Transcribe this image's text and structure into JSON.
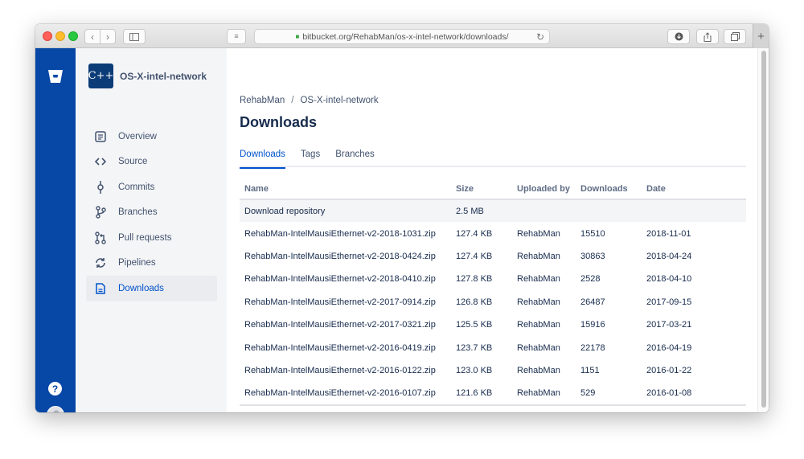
{
  "browser": {
    "url": "bitbucket.org/RehabMan/os-x-intel-network/downloads/",
    "back_icon": "chevron-left",
    "forward_icon": "chevron-right",
    "sidebar_toggle_icon": "sidebar",
    "reader_icon": "reader",
    "download_icon": "download",
    "share_icon": "share",
    "tabs_icon": "tab-overview",
    "new_tab_icon": "plus",
    "traffic_lights": {
      "close": "#fe5f57",
      "minimize": "#febc2e",
      "zoom": "#28c840"
    }
  },
  "rail": {
    "logo_icon": "bitbucket-logo",
    "help_label": "?",
    "user_icon": "user-avatar",
    "color": "#0747a6"
  },
  "repo": {
    "avatar_text": "C++",
    "name": "OS-X-intel-network"
  },
  "sidebar": {
    "items": [
      {
        "label": "Overview",
        "icon": "overview-icon"
      },
      {
        "label": "Source",
        "icon": "source-icon"
      },
      {
        "label": "Commits",
        "icon": "commits-icon"
      },
      {
        "label": "Branches",
        "icon": "branches-icon"
      },
      {
        "label": "Pull requests",
        "icon": "pull-requests-icon"
      },
      {
        "label": "Pipelines",
        "icon": "pipelines-icon"
      },
      {
        "label": "Downloads",
        "icon": "downloads-icon",
        "active": true
      }
    ]
  },
  "breadcrumb": {
    "owner": "RehabMan",
    "separator": "/",
    "repo": "OS-X-intel-network"
  },
  "page_title": "Downloads",
  "tabs": [
    {
      "label": "Downloads",
      "active": true
    },
    {
      "label": "Tags"
    },
    {
      "label": "Branches"
    }
  ],
  "table": {
    "headers": [
      "Name",
      "Size",
      "Uploaded by",
      "Downloads",
      "Date"
    ],
    "repo_row": {
      "name": "Download repository",
      "size": "2.5 MB"
    },
    "rows": [
      {
        "name": "RehabMan-IntelMausiEthernet-v2-2018-1031.zip",
        "size": "127.4 KB",
        "uploader": "RehabMan",
        "downloads": "15510",
        "date": "2018-11-01"
      },
      {
        "name": "RehabMan-IntelMausiEthernet-v2-2018-0424.zip",
        "size": "127.4 KB",
        "uploader": "RehabMan",
        "downloads": "30863",
        "date": "2018-04-24"
      },
      {
        "name": "RehabMan-IntelMausiEthernet-v2-2018-0410.zip",
        "size": "127.8 KB",
        "uploader": "RehabMan",
        "downloads": "2528",
        "date": "2018-04-10"
      },
      {
        "name": "RehabMan-IntelMausiEthernet-v2-2017-0914.zip",
        "size": "126.8 KB",
        "uploader": "RehabMan",
        "downloads": "26487",
        "date": "2017-09-15"
      },
      {
        "name": "RehabMan-IntelMausiEthernet-v2-2017-0321.zip",
        "size": "125.5 KB",
        "uploader": "RehabMan",
        "downloads": "15916",
        "date": "2017-03-21"
      },
      {
        "name": "RehabMan-IntelMausiEthernet-v2-2016-0419.zip",
        "size": "123.7 KB",
        "uploader": "RehabMan",
        "downloads": "22178",
        "date": "2016-04-19"
      },
      {
        "name": "RehabMan-IntelMausiEthernet-v2-2016-0122.zip",
        "size": "123.0 KB",
        "uploader": "RehabMan",
        "downloads": "1151",
        "date": "2016-01-22"
      },
      {
        "name": "RehabMan-IntelMausiEthernet-v2-2016-0107.zip",
        "size": "121.6 KB",
        "uploader": "RehabMan",
        "downloads": "529",
        "date": "2016-01-08"
      }
    ]
  },
  "colors": {
    "accent": "#0052cc",
    "rail": "#0747a6",
    "sidebar_bg": "#f4f5f7",
    "text": "#172b4d"
  }
}
